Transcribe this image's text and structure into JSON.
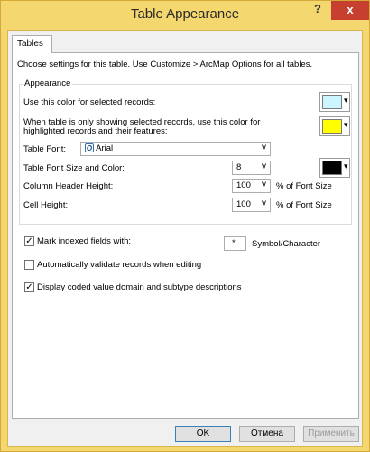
{
  "window": {
    "title": "Table Appearance",
    "help_glyph": "?",
    "close_glyph": "x"
  },
  "tabs": [
    "Tables"
  ],
  "intro": "Choose settings for this table. Use Customize > ArcMap Options for all tables.",
  "appearance": {
    "label": "Appearance",
    "selected_color_label": "Use this color for selected records:",
    "selected_color": "#ccf6ff",
    "highlight_label_line1": "When table is only showing selected records, use this color for",
    "highlight_label_line2": "highlighted records and their features:",
    "highlight_color": "#ffff00",
    "font_label": "Table Font:",
    "font_value": "Arial",
    "font_icon": "opentype-font-icon",
    "font_size_label": "Table Font Size and Color:",
    "font_size_value": "8",
    "font_color": "#000000",
    "column_header_label": "Column Header Height:",
    "column_header_value": "100",
    "column_header_unit": "% of Font Size",
    "cell_height_label": "Cell Height:",
    "cell_height_value": "100",
    "cell_height_unit": "% of Font Size"
  },
  "options": {
    "mark_indexed_label": "Mark indexed fields with:",
    "mark_indexed_checked": true,
    "mark_symbol": "*",
    "mark_symbol_label": "Symbol/Character",
    "auto_validate_label": "Automatically validate records when editing",
    "auto_validate_checked": false,
    "coded_domain_label": "Display coded value domain and subtype descriptions",
    "coded_domain_checked": true
  },
  "buttons": {
    "ok": "OK",
    "cancel": "Отмена",
    "apply": "Применить"
  },
  "colors": {
    "titlebar": "#f4d76f",
    "close": "#c7402f",
    "client": "#f0f0f0"
  }
}
